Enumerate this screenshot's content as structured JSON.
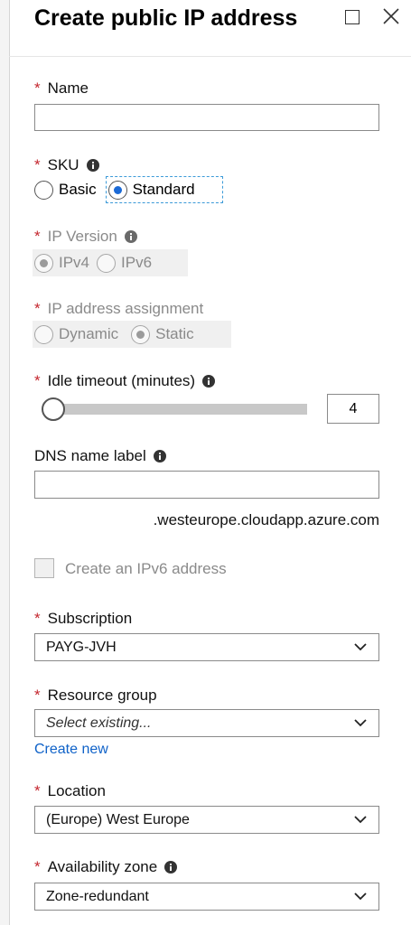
{
  "blade": {
    "title": "Create public IP address"
  },
  "form": {
    "name": {
      "label": "Name",
      "value": ""
    },
    "sku": {
      "label": "SKU",
      "options": [
        "Basic",
        "Standard"
      ],
      "selected": "Standard"
    },
    "ip_version": {
      "label": "IP Version",
      "options": [
        "IPv4",
        "IPv6"
      ],
      "selected": "IPv4",
      "disabled": true
    },
    "ip_assignment": {
      "label": "IP address assignment",
      "options": [
        "Dynamic",
        "Static"
      ],
      "selected": "Static",
      "disabled": true
    },
    "idle_timeout": {
      "label": "Idle timeout (minutes)",
      "value": "4",
      "min": 4,
      "max": 30
    },
    "dns_label": {
      "label": "DNS name label",
      "value": "",
      "suffix": ".westeurope.cloudapp.azure.com"
    },
    "ipv6_checkbox": {
      "label": "Create an IPv6 address",
      "checked": false,
      "disabled": true
    },
    "subscription": {
      "label": "Subscription",
      "value": "PAYG-JVH"
    },
    "resource_group": {
      "label": "Resource group",
      "placeholder": "Select existing...",
      "create_link": "Create new"
    },
    "location": {
      "label": "Location",
      "value": "(Europe) West Europe"
    },
    "availability_zone": {
      "label": "Availability zone",
      "value": "Zone-redundant"
    }
  },
  "colors": {
    "required": "#c4262e",
    "accent": "#1b6ad6",
    "link": "#0f62c8",
    "focus": "#3b9ad8"
  },
  "icons": [
    "maximize-icon",
    "close-icon",
    "info-icon",
    "chevron-down-icon"
  ]
}
